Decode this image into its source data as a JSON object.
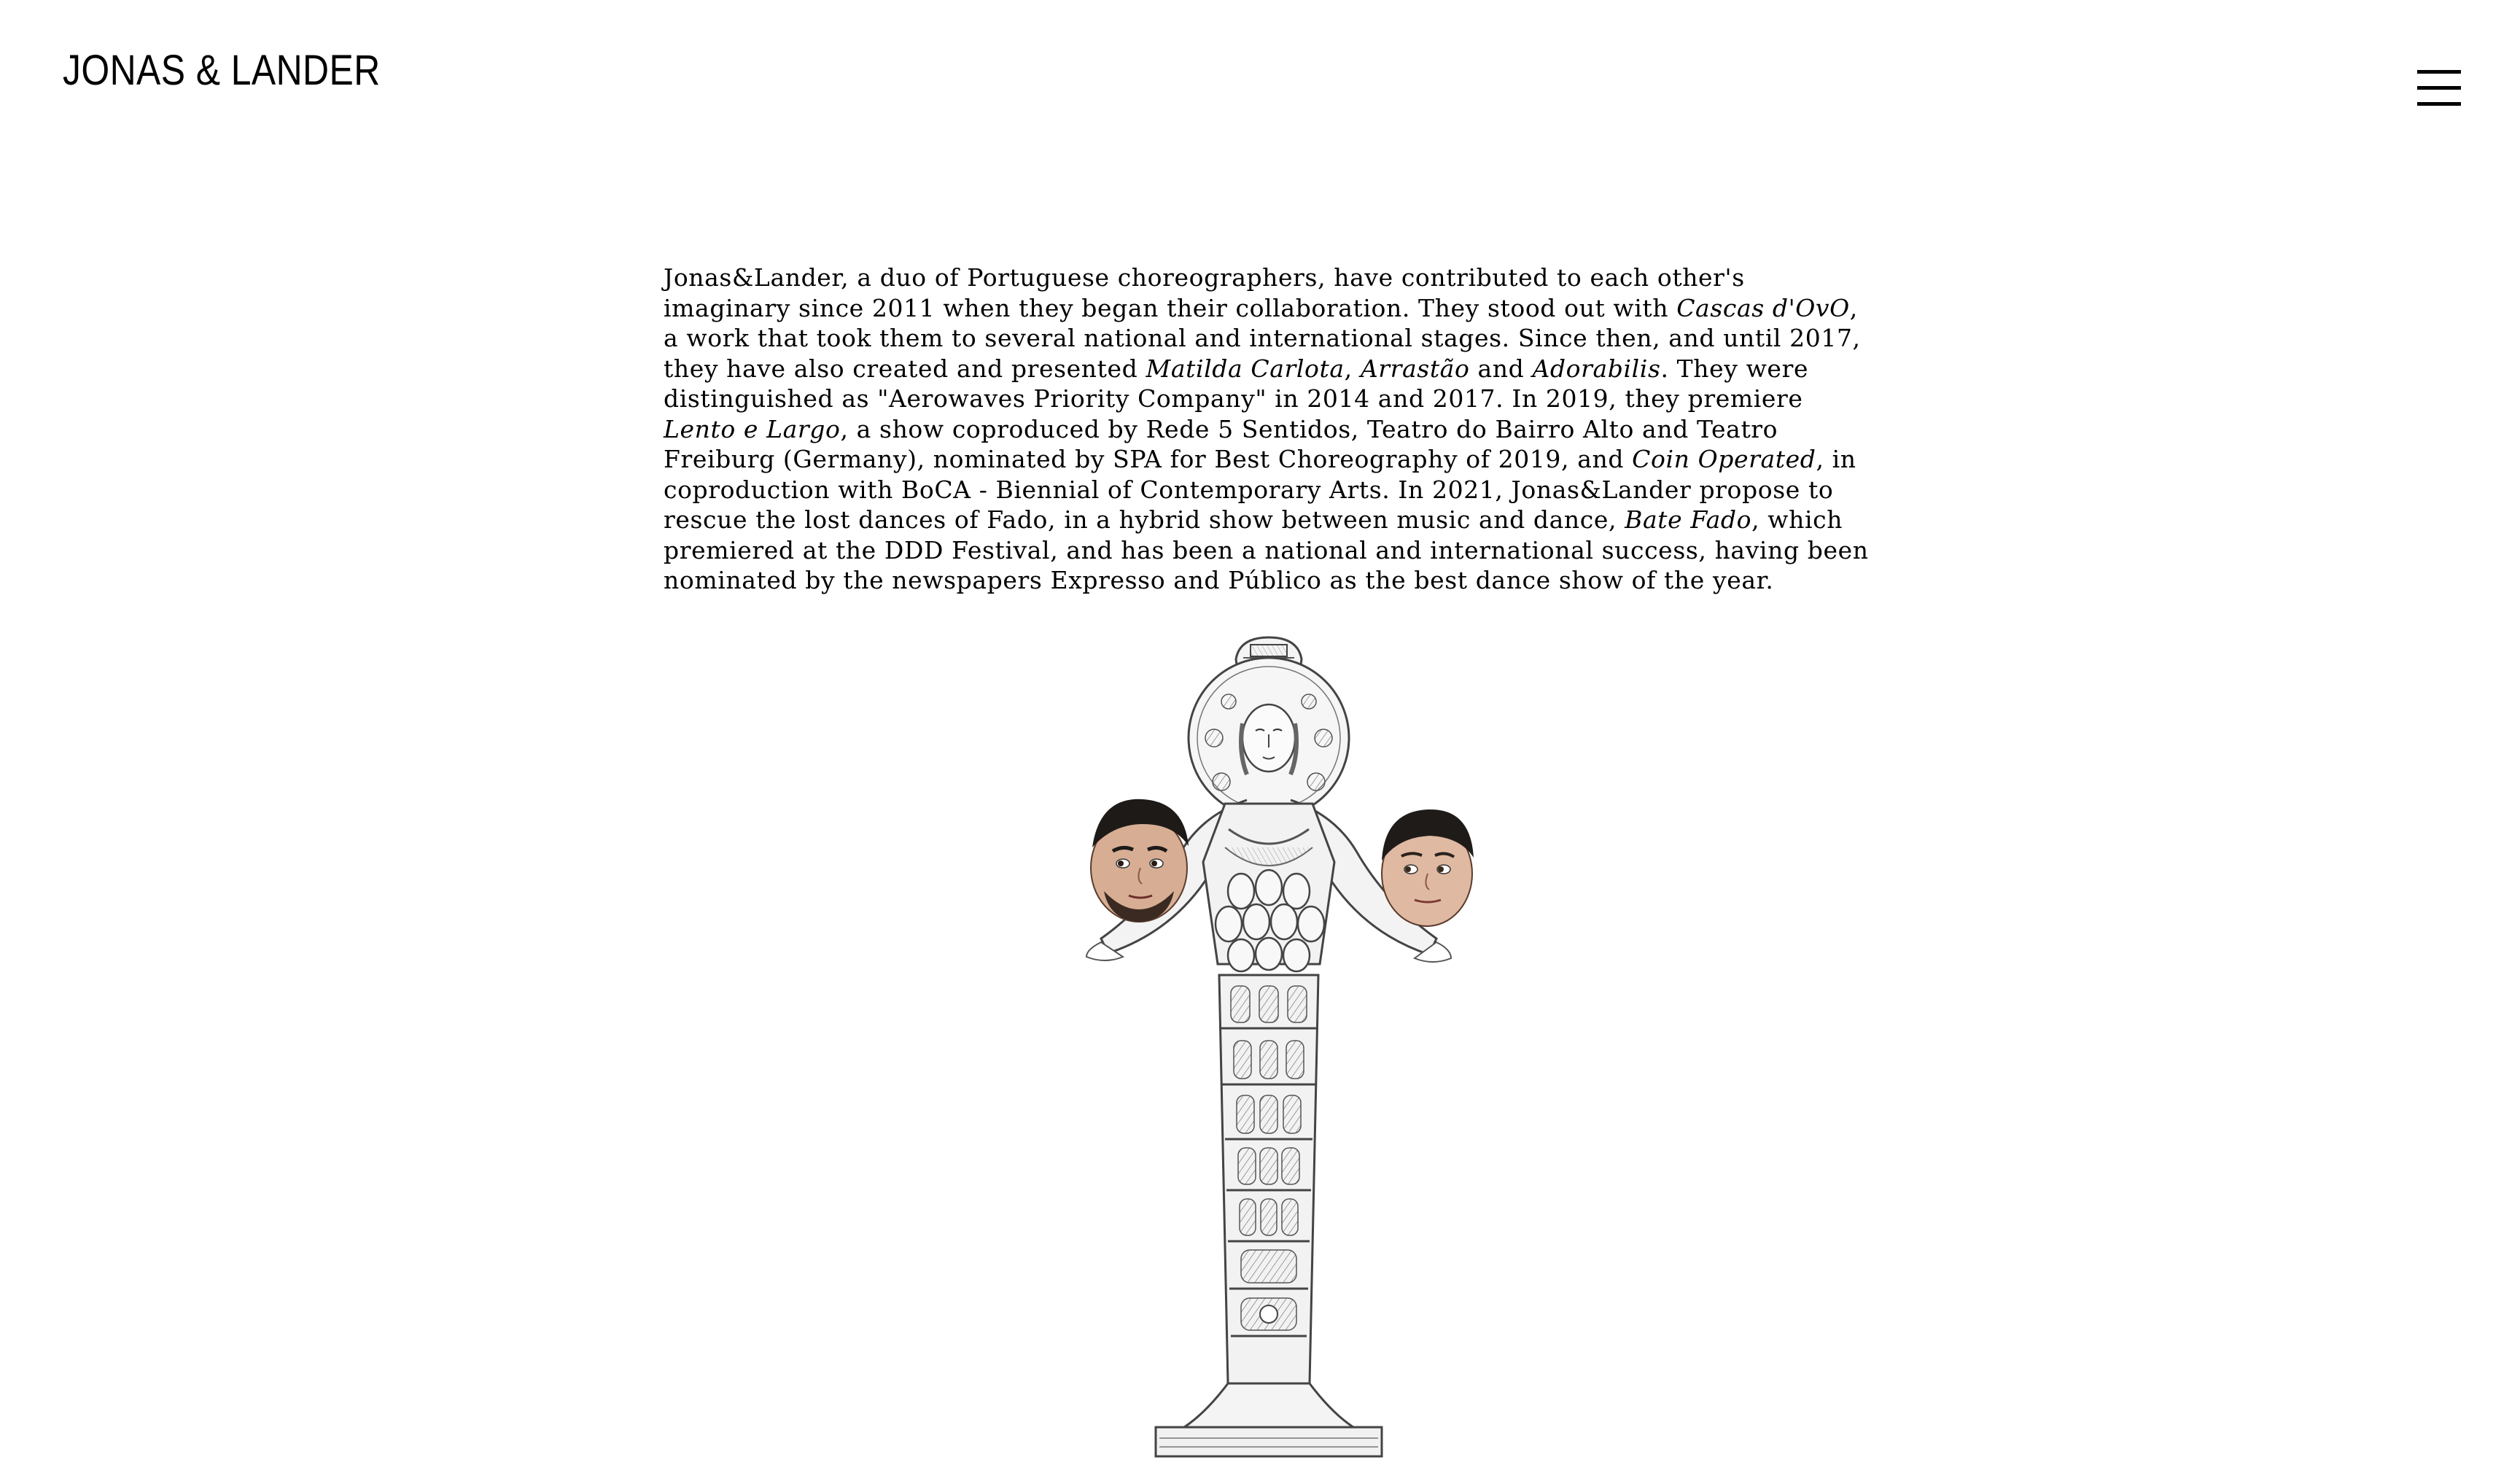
{
  "header": {
    "logo_text": "JONAS & LANDER",
    "menu_icon": "hamburger-menu-icon"
  },
  "bio": {
    "p1": "Jonas&Lander, a duo of Portuguese choreographers, have contributed to each other's imaginary since 2011 when they began their collaboration. They stood out with ",
    "work1": "Cascas d'OvO",
    "p2": ", a work that took them to several national and international stages. Since then, and until 2017, they have also created and presented ",
    "work2": "Matilda Carlota",
    "p3": ", ",
    "work3": "Arrastão",
    "p4": " and ",
    "work4": "Adorabilis",
    "p5": ". They were distinguished as \"Aerowaves Priority Company\" in 2014 and 2017. In 2019, they premiere ",
    "work5": "Lento e Largo",
    "p6": ", a show coproduced by Rede 5 Sentidos, Teatro do Bairro Alto and Teatro Freiburg (Germany), nominated by SPA for Best Choreography of 2019, and ",
    "work6": "Coin Operated",
    "p7": ", in coproduction with BoCA - Biennial of Contemporary Arts. In 2021, Jonas&Lander propose to rescue the lost dances of Fado, in a hybrid show between music and dance, ",
    "work7": "Bate Fado",
    "p8": ", which premiered at the DDD Festival, and has been a national and international success, having been nominated by the newspapers Expresso and Público as the best dance show of the year."
  },
  "colors": {
    "background": "#ffffff",
    "text": "#000000",
    "engraving": "#555555"
  }
}
